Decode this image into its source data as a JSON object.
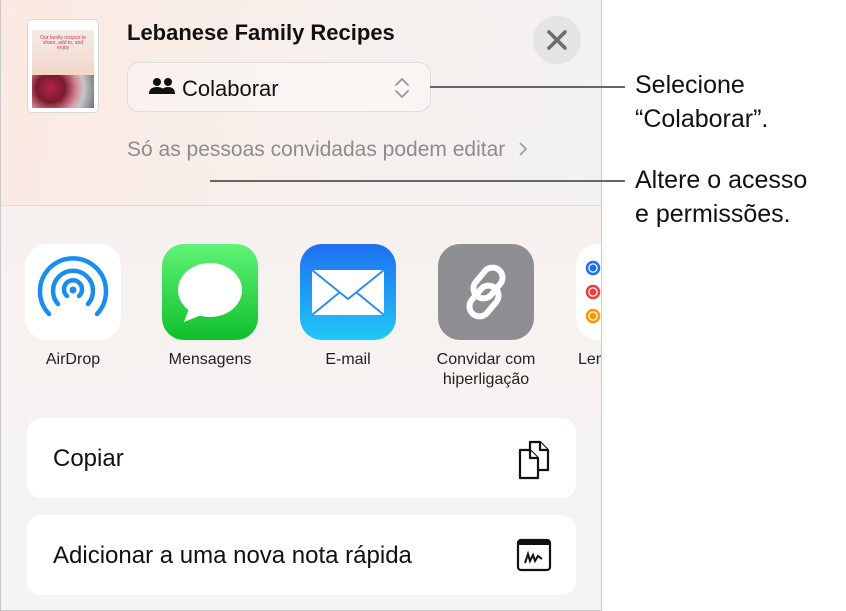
{
  "header": {
    "title": "Lebanese Family Recipes",
    "collab_select": {
      "value": "Colaborar"
    },
    "access_description": "Só as pessoas convidadas podem editar",
    "close_label": "Fechar"
  },
  "thumbnail": {
    "cover_text": "Our family recipes to share, add to, and enjoy"
  },
  "apps": [
    {
      "label": "AirDrop",
      "icon": "airdrop-icon",
      "color": "#1b8cf2"
    },
    {
      "label": "Mensagens",
      "icon": "messages-icon",
      "color": "#2fd34a"
    },
    {
      "label": "E-mail",
      "icon": "mail-icon",
      "color": "#1a86f0"
    },
    {
      "label": "Convidar com hiperligação",
      "icon": "link-icon",
      "color": "#8e8e93"
    },
    {
      "label": "Lembretes",
      "icon": "reminders-icon",
      "color": "#ffffff"
    }
  ],
  "actions": [
    {
      "label": "Copiar",
      "icon": "copy-icon"
    },
    {
      "label": "Adicionar a uma nova nota rápida",
      "icon": "quick-note-icon"
    }
  ],
  "callouts": [
    {
      "line1": "Selecione",
      "line2": "“Colaborar”."
    },
    {
      "line1": "Altere o acesso",
      "line2": "e permissões."
    }
  ]
}
